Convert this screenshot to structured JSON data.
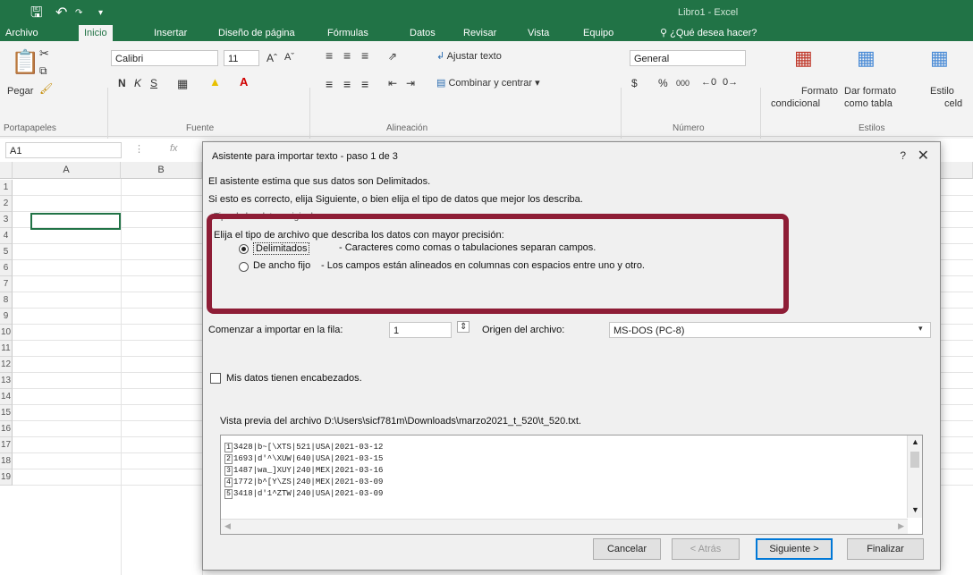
{
  "app": {
    "title": "Libro1 - Excel",
    "qat": {
      "save_icon": "save-icon",
      "undo_icon": "undo-icon"
    }
  },
  "ribbon_tabs": [
    "Archivo",
    "Inicio",
    "Insertar",
    "Diseño de página",
    "Fórmulas",
    "Datos",
    "Revisar",
    "Vista",
    "Equipo",
    "¿Qué desea hacer?"
  ],
  "ribbon": {
    "paste_label": "Pegar",
    "group_clipboard": "Portapapeles",
    "font_name": "Calibri",
    "font_size": "11",
    "bold": "N",
    "italic": "K",
    "underline": "S",
    "group_font": "Fuente",
    "wrap_text": "Ajustar texto",
    "merge_center": "Combinar y centrar",
    "group_alignment": "Alineación",
    "number_format": "General",
    "currency": "$",
    "percent": "%",
    "thousands": "000",
    "group_number": "Número",
    "cond_format_1": "Formato",
    "cond_format_2": "condicional",
    "format_table_1": "Dar formato",
    "format_table_2": "como tabla",
    "cell_styles_1": "Estilo",
    "cell_styles_2": "celd",
    "group_styles": "Estilos"
  },
  "formula_bar": {
    "name_box": "A1",
    "fx": "fx"
  },
  "grid": {
    "columns": [
      "A",
      "B"
    ],
    "rows": [
      "1",
      "2",
      "3",
      "4",
      "5",
      "6",
      "7",
      "8",
      "9",
      "10",
      "11",
      "12",
      "13",
      "14",
      "15",
      "16",
      "17",
      "18",
      "19"
    ]
  },
  "dialog": {
    "title": "Asistente para importar texto - paso 1 de 3",
    "help": "?",
    "close": "✕",
    "intro1": "El asistente estima que sus datos son Delimitados.",
    "intro2": "Si esto es correcto, elija Siguiente, o bien elija el tipo de datos que mejor los describa.",
    "group_title": "Tipo de los datos originales",
    "choose_label": "Elija el tipo de archivo que describa los datos con mayor precisión:",
    "opt_delimited": "Delimitados",
    "opt_delimited_desc": "- Caracteres como comas o tabulaciones separan campos.",
    "opt_fixed": "De ancho fijo",
    "opt_fixed_desc": "- Los campos están alineados en columnas con espacios entre uno y otro.",
    "start_row_label": "Comenzar a importar en la fila:",
    "start_row_value": "1",
    "origin_label": "Origen del archivo:",
    "origin_value": "MS-DOS (PC-8)",
    "headers_label": "Mis datos tienen encabezados.",
    "preview_label": "Vista previa del archivo D:\\Users\\sicf781m\\Downloads\\marzo2021_t_520\\t_520.txt.",
    "preview_lines": [
      {
        "n": "1",
        "text": "3428|b~[\\XTS|521|USA|2021-03-12"
      },
      {
        "n": "2",
        "text": "1693|d'^\\XUW|640|USA|2021-03-15"
      },
      {
        "n": "3",
        "text": "1487|wa_]XUY|240|MEX|2021-03-16"
      },
      {
        "n": "4",
        "text": "1772|b^[Y\\ZS|240|MEX|2021-03-09"
      },
      {
        "n": "5",
        "text": "3418|d'1^ZTW|240|USA|2021-03-09"
      }
    ],
    "btn_cancel": "Cancelar",
    "btn_back": "< Atrás",
    "btn_next": "Siguiente >",
    "btn_finish": "Finalizar"
  }
}
